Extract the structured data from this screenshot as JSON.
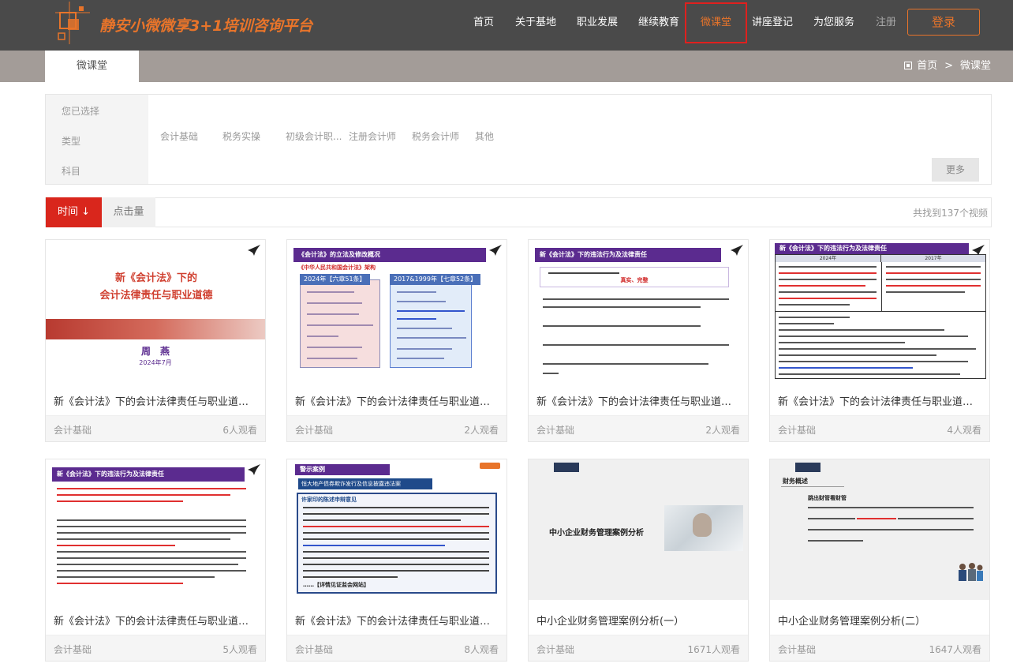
{
  "header": {
    "logo_text": "静安小微微享3+1培训咨询平台",
    "nav": [
      {
        "label": "首页",
        "active": false,
        "muted": false
      },
      {
        "label": "关于基地",
        "active": false,
        "muted": false
      },
      {
        "label": "职业发展",
        "active": false,
        "muted": false
      },
      {
        "label": "继续教育",
        "active": false,
        "muted": false
      },
      {
        "label": "微课堂",
        "active": true,
        "muted": false
      },
      {
        "label": "讲座登记",
        "active": false,
        "muted": false
      },
      {
        "label": "为您服务",
        "active": false,
        "muted": false
      },
      {
        "label": "注册",
        "active": false,
        "muted": true
      }
    ],
    "login_label": "登录"
  },
  "subbar": {
    "tab": "微课堂",
    "crumb_home": "首页",
    "crumb_sep": ">",
    "crumb_current": "微课堂"
  },
  "filter": {
    "selected_label": "您已选择",
    "type_label": "类型",
    "subject_label": "科目",
    "types": [
      "会计基础",
      "税务实操",
      "初级会计职...",
      "注册会计师",
      "税务会计师",
      "其他"
    ],
    "more_label": "更多"
  },
  "sort": {
    "time_label": "时间",
    "time_arrow": "↓",
    "clicks_label": "点击量",
    "total_text": "共找到137个视频"
  },
  "cards": [
    {
      "title": "新《会计法》下的会计法律责任与职业道德（...",
      "category": "会计基础",
      "views": "6人观看"
    },
    {
      "title": "新《会计法》下的会计法律责任与职业道德（...",
      "category": "会计基础",
      "views": "2人观看"
    },
    {
      "title": "新《会计法》下的会计法律责任与职业道德（...",
      "category": "会计基础",
      "views": "2人观看"
    },
    {
      "title": "新《会计法》下的会计法律责任与职业道德（...",
      "category": "会计基础",
      "views": "4人观看"
    },
    {
      "title": "新《会计法》下的会计法律责任与职业道德（...",
      "category": "会计基础",
      "views": "5人观看"
    },
    {
      "title": "新《会计法》下的会计法律责任与职业道德（...",
      "category": "会计基础",
      "views": "8人观看"
    },
    {
      "title": "中小企业财务管理案例分析(一）",
      "category": "会计基础",
      "views": "1671人观看"
    },
    {
      "title": "中小企业财务管理案例分析(二）",
      "category": "会计基础",
      "views": "1647人观看"
    }
  ],
  "thumbs": {
    "t1_title_line1": "新《会计法》下的",
    "t1_title_line2": "会计法律责任与职业道德",
    "t1_name": "周　燕",
    "t1_date": "2024年7月",
    "t2_banner": "《会计法》的立法及修改概况",
    "t2_sub": "《中华人民共和国会计法》架构",
    "t2_box1": "2024年【六章51条】",
    "t2_box2": "2017&1999年【七章52条】",
    "t3_banner": "新《会计法》下的违法行为及法律责任",
    "t3_red": "真实、完整",
    "t4_banner": "新《会计法》下的违法行为及法律责任",
    "t4_col1": "2024年",
    "t4_col2": "2017年",
    "t5_banner": "新《会计法》下的违法行为及法律责任",
    "t6_banner": "警示案例",
    "t6_sub": "恒大地产债券欺诈发行及信息披露违法案",
    "t6_head": "许家印的陈述申辩意见",
    "t6_foot": "……【详情见证监会网站】",
    "t7_title": "中小企业财务管理案例分析",
    "t8_title": "财务概述",
    "t8_sub": "跳出财管看财管"
  },
  "colors": {
    "header_bg": "#4a4a4a",
    "accent": "#e8742a",
    "active_border": "#e0201e",
    "sort_active": "#d9261c",
    "subbar_bg": "#a39c98"
  }
}
